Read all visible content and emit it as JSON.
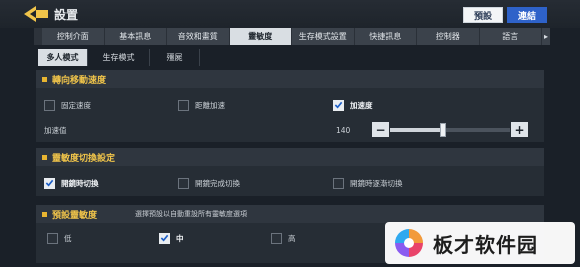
{
  "header": {
    "title": "設置",
    "default_btn": "預設",
    "connect_btn": "連結"
  },
  "tabs": [
    "控制介面",
    "基本訊息",
    "音效和畫質",
    "靈敏度",
    "生存模式設置",
    "快捷訊息",
    "控制器",
    "語言"
  ],
  "active_tab_index": 3,
  "subtabs": [
    "多人模式",
    "生存模式",
    "殭屍"
  ],
  "active_subtab_index": 0,
  "section_turn": {
    "title": "轉向移動速度",
    "options": [
      {
        "label": "固定速度",
        "checked": false
      },
      {
        "label": "距離加速",
        "checked": false
      },
      {
        "label": "加速度",
        "checked": true
      }
    ],
    "accel_label": "加速值",
    "accel_value": "140",
    "accel_fraction": 0.44,
    "minus": "−",
    "plus": "+"
  },
  "section_switch": {
    "title": "靈敏度切換設定",
    "options": [
      {
        "label": "開鏡時切換",
        "checked": true
      },
      {
        "label": "開鏡完成切換",
        "checked": false
      },
      {
        "label": "開鏡時逐漸切換",
        "checked": false
      }
    ]
  },
  "section_preset": {
    "title": "預設靈敏度",
    "hint": "選擇預設以自動重設所有靈敏度選項",
    "options": [
      {
        "label": "低",
        "checked": false
      },
      {
        "label": "中",
        "checked": true
      },
      {
        "label": "高",
        "checked": false
      }
    ]
  },
  "watermark": {
    "text": "板才软件园"
  },
  "colors": {
    "accent_yellow": "#f0c44a",
    "connect_blue": "#2e62c9",
    "bg": "#1a2028"
  }
}
